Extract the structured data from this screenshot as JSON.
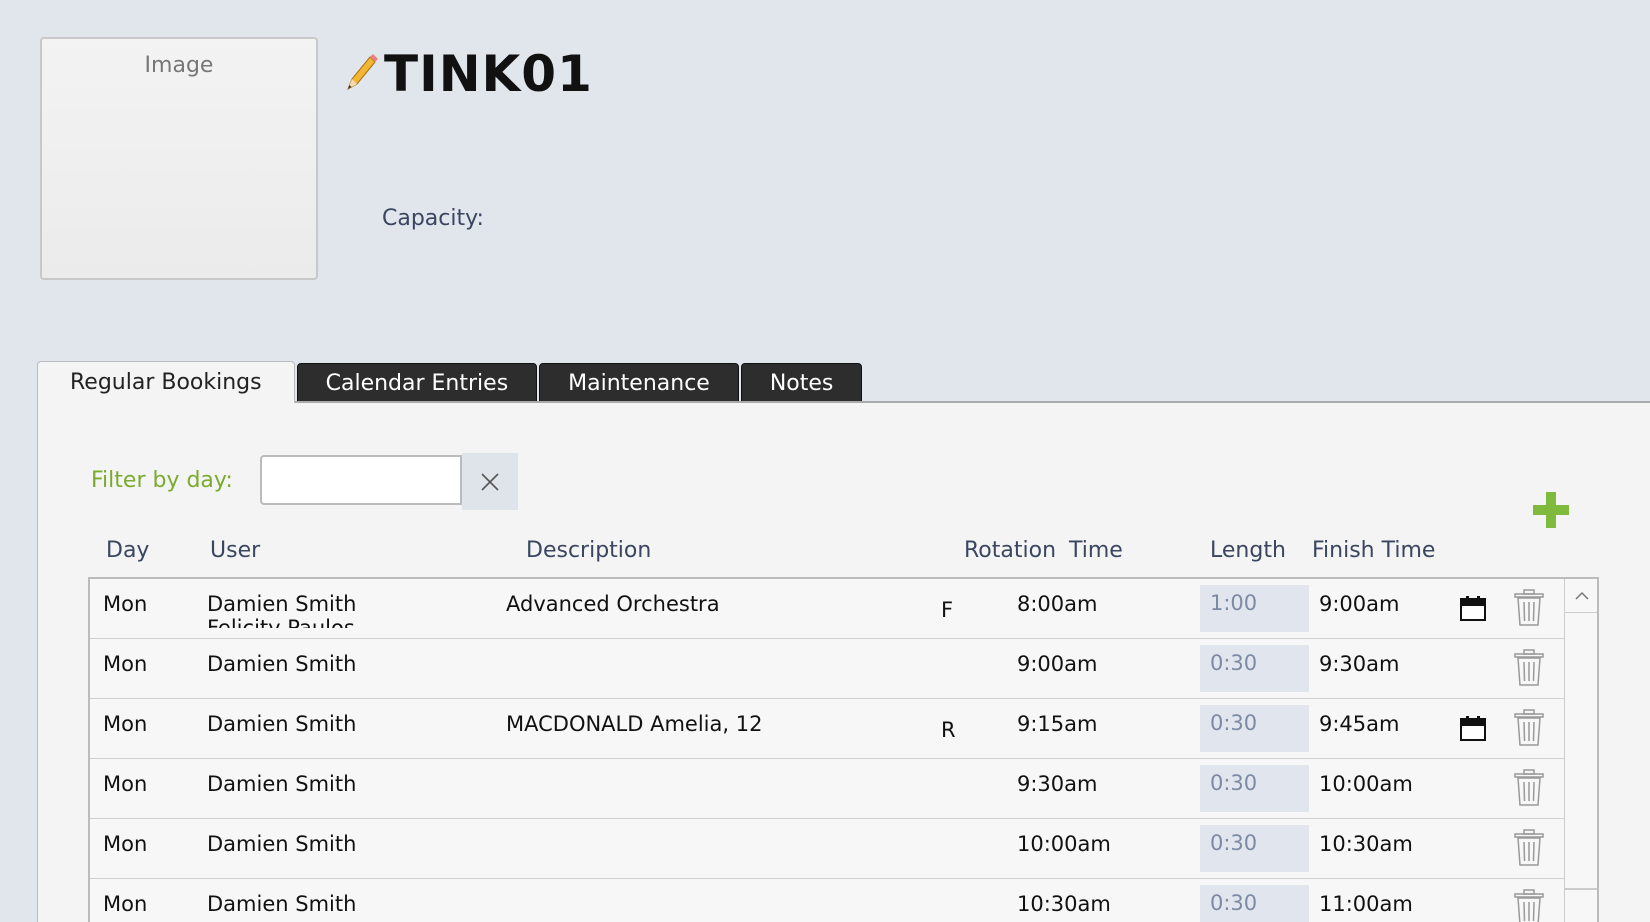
{
  "header": {
    "image_placeholder": "Image",
    "title": "TINK01",
    "capacity_label": "Capacity:"
  },
  "tabs": [
    {
      "label": "Regular Bookings",
      "active": true
    },
    {
      "label": "Calendar Entries",
      "active": false
    },
    {
      "label": "Maintenance",
      "active": false
    },
    {
      "label": "Notes",
      "active": false
    }
  ],
  "filter": {
    "label": "Filter by day:",
    "value": "",
    "clear_icon": "close-icon"
  },
  "add_icon": "plus-icon",
  "columns": [
    "Day",
    "User",
    "Description",
    "Rotation",
    "Time",
    "Length",
    "Finish Time"
  ],
  "rows": [
    {
      "day": "Mon",
      "user": "Damien Smith",
      "user2": "Felicity Paulos",
      "description": "Advanced Orchestra",
      "rotation": "F",
      "time": "8:00am",
      "length": "1:00",
      "finish": "9:00am",
      "calendar": true
    },
    {
      "day": "Mon",
      "user": "Damien Smith",
      "user2": "",
      "description": "",
      "rotation": "",
      "time": "9:00am",
      "length": "0:30",
      "finish": "9:30am",
      "calendar": false
    },
    {
      "day": "Mon",
      "user": "Damien Smith",
      "user2": "",
      "description": "MACDONALD Amelia, 12",
      "rotation": "R",
      "time": "9:15am",
      "length": "0:30",
      "finish": "9:45am",
      "calendar": true
    },
    {
      "day": "Mon",
      "user": "Damien Smith",
      "user2": "",
      "description": "",
      "rotation": "",
      "time": "9:30am",
      "length": "0:30",
      "finish": "10:00am",
      "calendar": false
    },
    {
      "day": "Mon",
      "user": "Damien Smith",
      "user2": "",
      "description": "",
      "rotation": "",
      "time": "10:00am",
      "length": "0:30",
      "finish": "10:30am",
      "calendar": false
    },
    {
      "day": "Mon",
      "user": "Damien Smith",
      "user2": "",
      "description": "",
      "rotation": "",
      "time": "10:30am",
      "length": "0:30",
      "finish": "11:00am",
      "calendar": false
    }
  ],
  "colors": {
    "accent_green": "#7aab2e",
    "tab_dark": "#2d2d2d",
    "background": "#e1e5ec"
  }
}
